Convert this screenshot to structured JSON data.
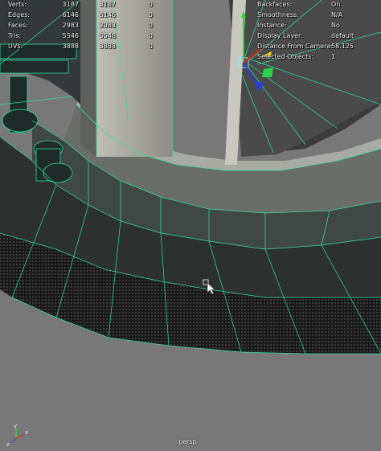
{
  "hud_left": {
    "rows": [
      {
        "label": "Verts:",
        "v1": "3187",
        "v2": "3187",
        "v3": "0"
      },
      {
        "label": "Edges:",
        "v1": "6146",
        "v2": "6146",
        "v3": "0"
      },
      {
        "label": "Faces:",
        "v1": "2983",
        "v2": "2983",
        "v3": "0"
      },
      {
        "label": "Tris:",
        "v1": "5546",
        "v2": "5546",
        "v3": "0"
      },
      {
        "label": "UVs:",
        "v1": "3888",
        "v2": "3888",
        "v3": "0"
      }
    ]
  },
  "hud_right": {
    "rows": [
      {
        "label": "Backfaces:",
        "value": "On"
      },
      {
        "label": "Smoothness:",
        "value": "N/A"
      },
      {
        "label": "Instance:",
        "value": "No"
      },
      {
        "label": "Display Layer:",
        "value": "default"
      },
      {
        "label": "Distance From Camera:",
        "value": "58.125"
      },
      {
        "label": "Selected Objects:",
        "value": "1"
      }
    ]
  },
  "camera": {
    "label": "persp"
  },
  "axis": {
    "x": "x",
    "y": "y",
    "z": "z"
  },
  "colors": {
    "wire": "#2fe0a0",
    "background": "#787878",
    "floor": "#1b1b1b"
  }
}
